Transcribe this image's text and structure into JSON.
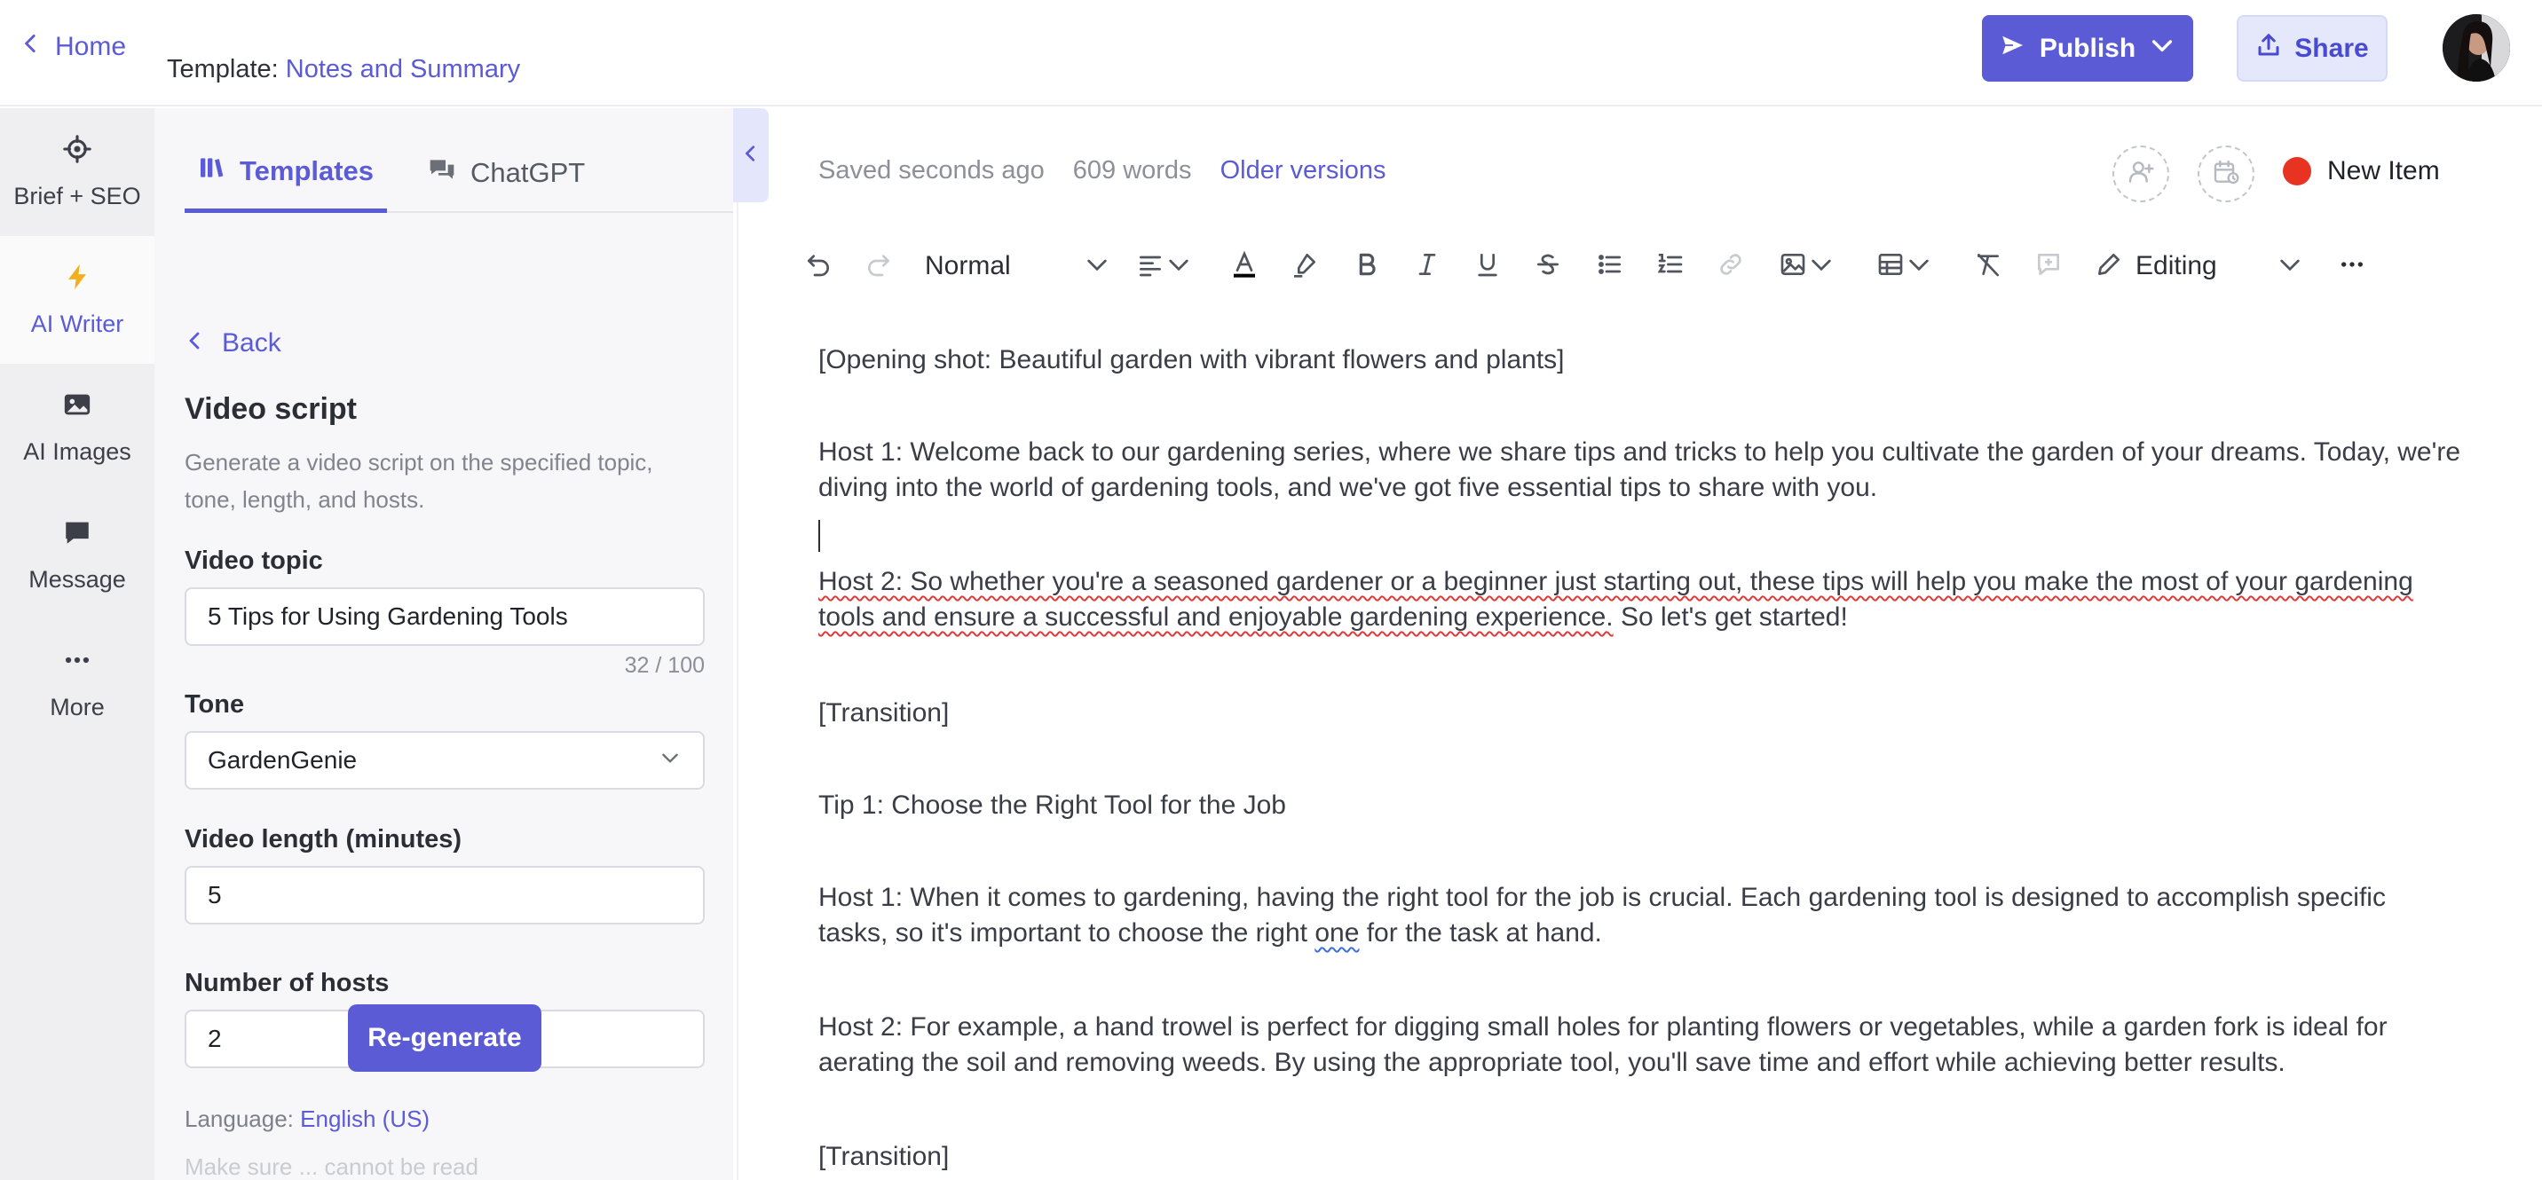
{
  "header": {
    "home_label": "Home",
    "template_prefix": "Template:",
    "template_name": "Notes and Summary",
    "publish_label": "Publish",
    "share_label": "Share"
  },
  "rail": {
    "items": [
      {
        "label": "Brief + SEO",
        "icon": "crosshair-icon"
      },
      {
        "label": "AI Writer",
        "icon": "bolt-icon",
        "active": true
      },
      {
        "label": "AI Images",
        "icon": "image-icon"
      },
      {
        "label": "Message",
        "icon": "message-icon"
      },
      {
        "label": "More",
        "icon": "more-icon"
      }
    ]
  },
  "panel": {
    "tabs": [
      {
        "label": "Templates",
        "icon": "books-icon",
        "active": true
      },
      {
        "label": "ChatGPT",
        "icon": "chat-icon"
      }
    ],
    "back_label": "Back",
    "title": "Video script",
    "description": "Generate a video script on the specified topic, tone, length, and hosts.",
    "fields": {
      "topic_label": "Video topic",
      "topic_value": "5 Tips for Using Gardening Tools",
      "topic_counter": "32 / 100",
      "tone_label": "Tone",
      "tone_value": "GardenGenie",
      "length_label": "Video length (minutes)",
      "length_value": "5",
      "hosts_label": "Number of hosts",
      "hosts_value": "2"
    },
    "regenerate_label": "Re-generate",
    "language_label": "Language:",
    "language_value": "English (US)",
    "cut_off_text": "Make sure ... cannot be read"
  },
  "editor": {
    "saved_status": "Saved seconds ago",
    "word_count": "609 words",
    "older_versions_label": "Older versions",
    "new_item_label": "New Item",
    "status_color": "#e83322",
    "toolbar": {
      "style_value": "Normal",
      "mode_value": "Editing"
    },
    "paragraphs": {
      "p1": "[Opening shot: Beautiful garden with vibrant flowers and plants]",
      "p2": "Host 1: Welcome back to our gardening series, where we share tips and tricks to help you cultivate the garden of your dreams. Today, we're diving into the world of gardening tools, and we've got five essential tips to share with you.",
      "p3a": "Host 2: So whether you're a seasoned gardener or a beginner just starting out, these tips will help you make the most of your gardening tools and ensure a successful and enjoyable gardening experience.",
      "p3b": " So let's get started!",
      "p4": "[Transition]",
      "p5": "Tip 1: Choose the Right Tool for the Job",
      "p6a": "Host 1: When it comes to gardening, having the right tool for the job is crucial. Each gardening tool is designed to accomplish specific tasks, so it's important to choose the right ",
      "p6b": "one",
      "p6c": " for the task at hand.",
      "p7": "Host 2: For example, a hand trowel is perfect for digging small holes for planting flowers or vegetables, while a garden fork is ideal for aerating the soil and removing weeds. By using the appropriate tool, you'll save time and effort while achieving better results.",
      "p8": "[Transition]"
    }
  },
  "colors": {
    "accent": "#5b5bd6",
    "rail_bg": "#efeff2",
    "panel_bg": "#f7f7f9"
  }
}
